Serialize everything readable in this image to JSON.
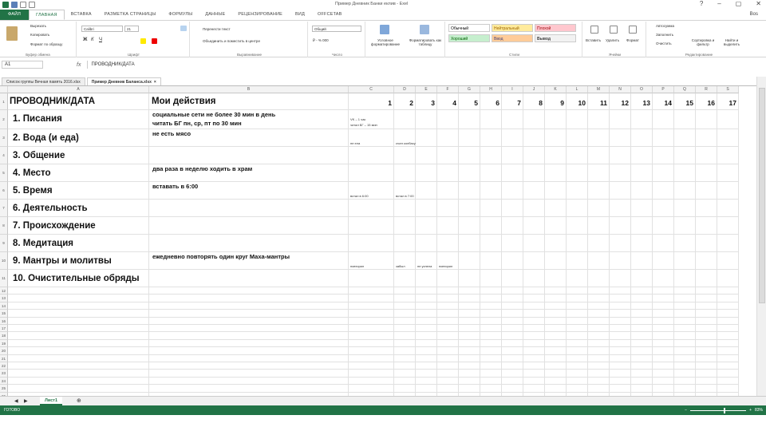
{
  "titlebar": {
    "title": "Пример Дневник Банки еклив - Exel",
    "min": "–",
    "restore": "▢",
    "close": "✕",
    "help": "?"
  },
  "ribbon_tabs": [
    "ФАЙЛ",
    "ГЛАВНАЯ",
    "ВСТАВКА",
    "РАЗМЕТКА СТРАНИЦЫ",
    "ФОРМУЛЫ",
    "ДАННЫЕ",
    "РЕЦЕНЗИРОВАНИЕ",
    "ВИД",
    "OFFCETAB"
  ],
  "user": "Bos",
  "ribbon": {
    "clipboard": {
      "cut": "Вырезать",
      "copy": "Копировать",
      "format": "Формат по образцу",
      "label": "Буфер обмена"
    },
    "font": {
      "family": "Calibri",
      "size": "21",
      "label": "Шрифт"
    },
    "align": {
      "wrap": "Перенести текст",
      "merge": "Объединить и поместить в центре",
      "label": "Выравнивание"
    },
    "number": {
      "format": "Общий",
      "label": "Число"
    },
    "cond": "Условное форматирование",
    "table": "Форматировать как таблицу",
    "styles": {
      "normal": "Обычный",
      "neutral": "Нейтральный",
      "bad": "Плохой",
      "good": "Хороший",
      "input": "Ввод",
      "output": "Вывод",
      "label": "Стили"
    },
    "cells": {
      "insert": "Вставить",
      "delete": "Удалить",
      "format": "Формат",
      "label": "Ячейки"
    },
    "edit": {
      "autosum": "Автосумма",
      "fill": "Заполнить",
      "clear": "Очистить",
      "sort": "Сортировка и фильтр",
      "find": "Найти и выделить",
      "label": "Редактирование"
    }
  },
  "formula_bar": {
    "name": "A1",
    "fx": "fx",
    "content": "ПРОВОДНИК/ДАТА"
  },
  "doc_tabs": [
    {
      "label": "Список группы Вечная память 2016.xlsx",
      "active": false
    },
    {
      "label": "Пример Дневник Баланса.xlsx",
      "active": true
    }
  ],
  "columns": [
    "A",
    "B",
    "C",
    "D",
    "E",
    "F",
    "G",
    "H",
    "I",
    "J",
    "K",
    "L",
    "M",
    "N",
    "O",
    "P",
    "Q",
    "R",
    "S"
  ],
  "header_row": {
    "a": "ПРОВОДНИК/ДАТА",
    "b": "Мои действия",
    "days": [
      "1",
      "2",
      "3",
      "4",
      "5",
      "6",
      "7",
      "8",
      "9",
      "10",
      "11",
      "12",
      "13",
      "14",
      "15",
      "16",
      "17"
    ]
  },
  "rows": [
    {
      "a": "1. Писания",
      "b1": "социальные сети не более 30 мин в день",
      "b2": "читать БГ пн, ср, пт по 30 мин",
      "c1": "VK – 1 час",
      "c2": "читал БГ – 15 мин"
    },
    {
      "a": "2. Вода (и еда)",
      "b1": "не есть мясо",
      "c1": "не ела",
      "d1": "съел колбасу"
    },
    {
      "a": "3. Общение"
    },
    {
      "a": "4. Место",
      "b1": "два раза в неделю ходить в храм"
    },
    {
      "a": "5. Время",
      "b1": "вставать в 6:00",
      "c1": "встал в 6:00",
      "d1": "встал в 7:00"
    },
    {
      "a": "6. Деятельность"
    },
    {
      "a": "7. Происхождение"
    },
    {
      "a": "8. Медитация"
    },
    {
      "a": "9. Мантры и молитвы",
      "b1": "ежедневно повторять один круг Маха-мантры",
      "c1": "повторил",
      "d1": "забыл",
      "e1": "не успела",
      "f1": "повторил"
    },
    {
      "a": "10. Очистительные обряды"
    }
  ],
  "sheet_tab": "Лист1",
  "status": {
    "ready": "ГОТОВО",
    "zoom": "83%"
  }
}
